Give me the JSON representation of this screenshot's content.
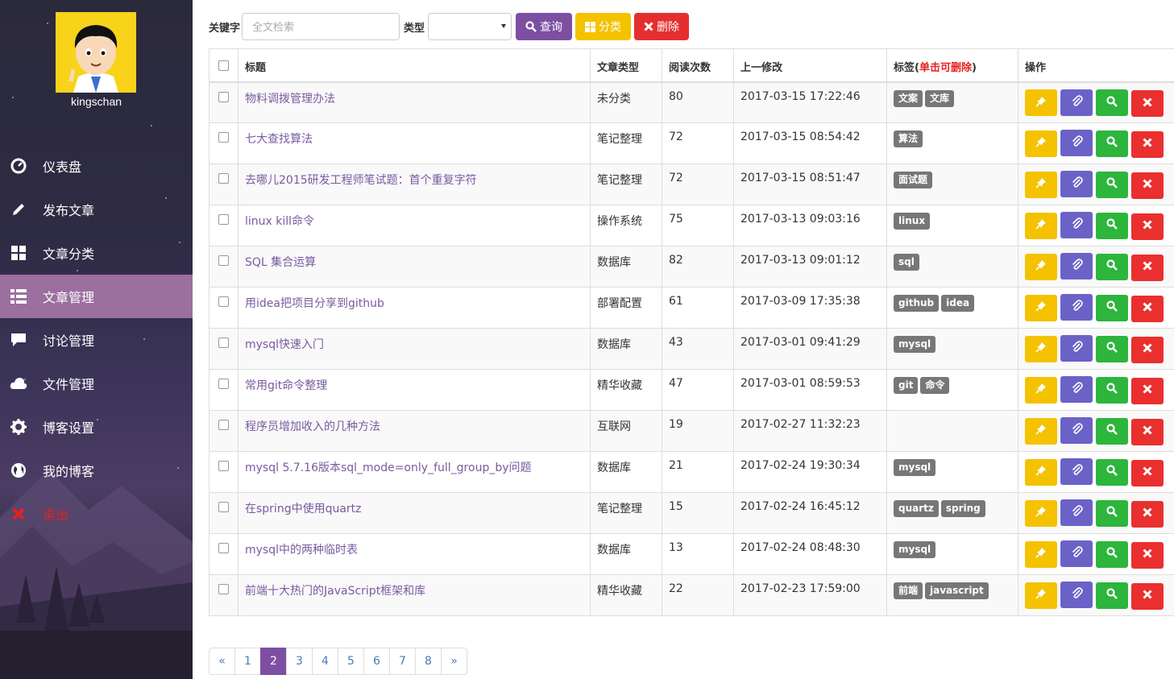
{
  "user": {
    "name": "kingschan"
  },
  "nav": [
    {
      "key": "dashboard",
      "label": "仪表盘",
      "icon": "dashboard-icon"
    },
    {
      "key": "publish",
      "label": "发布文章",
      "icon": "pencil-icon"
    },
    {
      "key": "category",
      "label": "文章分类",
      "icon": "grid-icon"
    },
    {
      "key": "manage",
      "label": "文章管理",
      "icon": "list-icon",
      "active": true
    },
    {
      "key": "discussion",
      "label": "讨论管理",
      "icon": "comment-icon"
    },
    {
      "key": "files",
      "label": "文件管理",
      "icon": "cloud-icon"
    },
    {
      "key": "settings",
      "label": "博客设置",
      "icon": "gear-icon"
    },
    {
      "key": "myblog",
      "label": "我的博客",
      "icon": "globe-icon"
    },
    {
      "key": "logout",
      "label": "退出",
      "icon": "close-icon"
    }
  ],
  "toolbar": {
    "keyword_label": "关键字",
    "keyword_placeholder": "全文检索",
    "type_label": "类型",
    "type_value": "",
    "query_label": "查询",
    "category_label": "分类",
    "delete_label": "删除"
  },
  "table": {
    "headers": {
      "title": "标题",
      "type": "文章类型",
      "reads": "阅读次数",
      "modified": "上一修改",
      "tags_prefix": "标签(",
      "tags_hint": "单击可删除",
      "tags_suffix": ")",
      "ops": "操作"
    },
    "rows": [
      {
        "title": "物料调拨管理办法",
        "type": "未分类",
        "reads": "80",
        "modified": "2017-03-15 17:22:46",
        "tags": [
          "文案",
          "文库"
        ]
      },
      {
        "title": "七大查找算法",
        "type": "笔记整理",
        "reads": "72",
        "modified": "2017-03-15 08:54:42",
        "tags": [
          "算法"
        ]
      },
      {
        "title": "去哪儿2015研发工程师笔试题：首个重复字符",
        "type": "笔记整理",
        "reads": "72",
        "modified": "2017-03-15 08:51:47",
        "tags": [
          "面试题"
        ]
      },
      {
        "title": "linux kill命令",
        "type": "操作系统",
        "reads": "75",
        "modified": "2017-03-13 09:03:16",
        "tags": [
          "linux"
        ]
      },
      {
        "title": "SQL 集合运算",
        "type": "数据库",
        "reads": "82",
        "modified": "2017-03-13 09:01:12",
        "tags": [
          "sql"
        ]
      },
      {
        "title": "用idea把项目分享到github",
        "type": "部署配置",
        "reads": "61",
        "modified": "2017-03-09 17:35:38",
        "tags": [
          "github",
          "idea"
        ]
      },
      {
        "title": "mysql快速入门",
        "type": "数据库",
        "reads": "43",
        "modified": "2017-03-01 09:41:29",
        "tags": [
          "mysql"
        ]
      },
      {
        "title": "常用git命令整理",
        "type": "精华收藏",
        "reads": "47",
        "modified": "2017-03-01 08:59:53",
        "tags": [
          "git",
          "命令"
        ]
      },
      {
        "title": "程序员增加收入的几种方法",
        "type": "互联网",
        "reads": "19",
        "modified": "2017-02-27 11:32:23",
        "tags": []
      },
      {
        "title": "mysql 5.7.16版本sql_mode=only_full_group_by问题",
        "type": "数据库",
        "reads": "21",
        "modified": "2017-02-24 19:30:34",
        "tags": [
          "mysql"
        ]
      },
      {
        "title": "在spring中使用quartz",
        "type": "笔记整理",
        "reads": "15",
        "modified": "2017-02-24 16:45:12",
        "tags": [
          "quartz",
          "spring"
        ]
      },
      {
        "title": "mysql中的两种临时表",
        "type": "数据库",
        "reads": "13",
        "modified": "2017-02-24 08:48:30",
        "tags": [
          "mysql"
        ]
      },
      {
        "title": "前端十大热门的JavaScript框架和库",
        "type": "精华收藏",
        "reads": "22",
        "modified": "2017-02-23 17:59:00",
        "tags": [
          "前端",
          "javascript"
        ]
      }
    ]
  },
  "pagination": {
    "prev": "«",
    "next": "»",
    "pages": [
      "1",
      "2",
      "3",
      "4",
      "5",
      "6",
      "7",
      "8"
    ],
    "current": "2"
  },
  "colors": {
    "accent": "#7c4fa3",
    "sidebar_active": "#9b6f9e",
    "warning": "#f5c200",
    "danger": "#ea2f2f",
    "success": "#2db53c",
    "info": "#6b62c8",
    "tag": "#777777"
  }
}
